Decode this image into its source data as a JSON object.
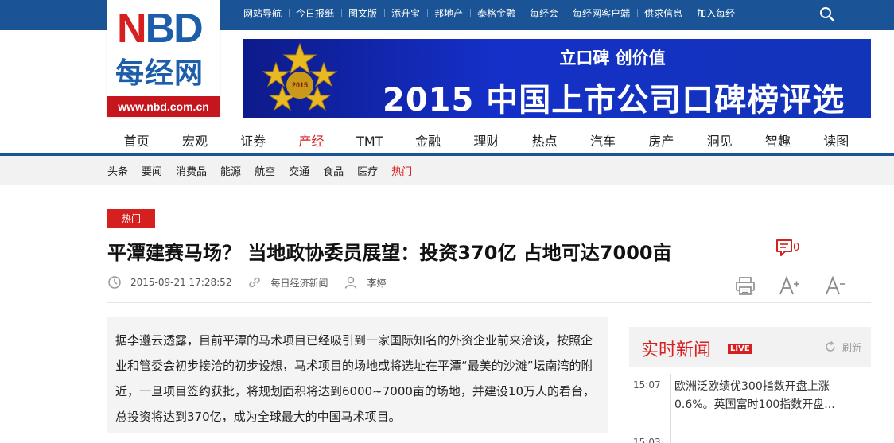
{
  "topnav": {
    "items": [
      "网站导航",
      "今日报纸",
      "图文版",
      "添升宝",
      "邦地产",
      "泰格金融",
      "每经会",
      "每经网客户端",
      "供求信息",
      "加入每经"
    ]
  },
  "logo": {
    "mark": "NBD",
    "name_cn": "每经网",
    "url": "www.nbd.com.cn"
  },
  "banner": {
    "line1": "立口碑 创价值",
    "line2": "2015 中国上市公司口碑榜评选",
    "badge_text": "2015"
  },
  "mainnav": {
    "items": [
      "首页",
      "宏观",
      "证券",
      "产经",
      "TMT",
      "金融",
      "理财",
      "热点",
      "汽车",
      "房产",
      "洞见",
      "智趣",
      "读图"
    ],
    "active": "产经"
  },
  "subnav": {
    "items": [
      "头条",
      "要闻",
      "消费品",
      "能源",
      "航空",
      "交通",
      "食品",
      "医疗",
      "热门"
    ],
    "active": "热门"
  },
  "article": {
    "tag": "热门",
    "headline": "平潭建赛马场？ 当地政协委员展望：投资370亿 占地可达7000亩",
    "comment_count": "0",
    "datetime": "2015-09-21 17:28:52",
    "source": "每日经济新闻",
    "author": "李婷",
    "summary": "据李遵云透露，目前平潭的马术项目已经吸引到一家国际知名的外资企业前来洽谈，按照企业和管委会初步接洽的初步设想，马术项目的场地或将选址在平潭“最美的沙滩”坛南湾的附近，一旦项目签约获批，将规划面积将达到6000~7000亩的场地，并建设10万人的看台，总投资将达到370亿，成为全球最大的中国马术项目。"
  },
  "side": {
    "title": "实时新闻",
    "live": "LIVE",
    "refresh": "刷新",
    "news": [
      {
        "time": "15:07",
        "text": "欧洲泛欧绩优300指数开盘上涨0.6%。英国富时100指数开盘..."
      },
      {
        "time": "15:03",
        "text": ""
      }
    ]
  },
  "colors": {
    "brand_blue": "#1b5496",
    "accent_red": "#d62020"
  }
}
